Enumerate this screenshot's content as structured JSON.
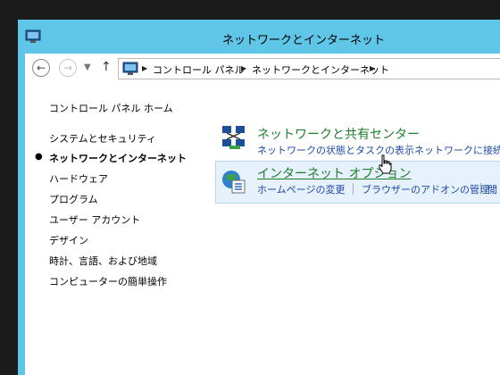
{
  "window": {
    "title": "ネットワークとインターネット",
    "title_icon": "control-panel-icon"
  },
  "navigation": {
    "back_icon": "back-arrow-icon",
    "forward_icon": "forward-arrow-icon",
    "recent_icon": "chevron-down-icon",
    "up_icon": "up-arrow-icon"
  },
  "breadcrumb": {
    "items": [
      "コントロール パネル",
      "ネットワークとインターネット"
    ]
  },
  "sidebar": {
    "items": [
      {
        "label": "コントロール パネル ホーム",
        "active": false
      },
      {
        "label": "システムとセキュリティ",
        "active": false
      },
      {
        "label": "ネットワークとインターネット",
        "active": true
      },
      {
        "label": "ハードウェア",
        "active": false
      },
      {
        "label": "プログラム",
        "active": false
      },
      {
        "label": "ユーザー アカウント",
        "active": false
      },
      {
        "label": "デザイン",
        "active": false
      },
      {
        "label": "時計、言語、および地域",
        "active": false
      },
      {
        "label": "コンピューターの簡単操作",
        "active": false
      }
    ]
  },
  "categories": [
    {
      "title": "ネットワークと共有センター",
      "icon": "network-sharing-center-icon",
      "tasks": [
        "ネットワークの状態とタスクの表示",
        "ネットワークに接続"
      ]
    },
    {
      "title": "インターネット オプション",
      "icon": "internet-options-icon",
      "tasks": [
        "ホームページの変更",
        "ブラウザーのアドオンの管理",
        "閲"
      ]
    }
  ],
  "colors": {
    "title_bar": "#5fc6e7",
    "category_title": "#1e7d2e",
    "task_link": "#1f4aa8",
    "hover_bg": "#e6f1fb"
  }
}
